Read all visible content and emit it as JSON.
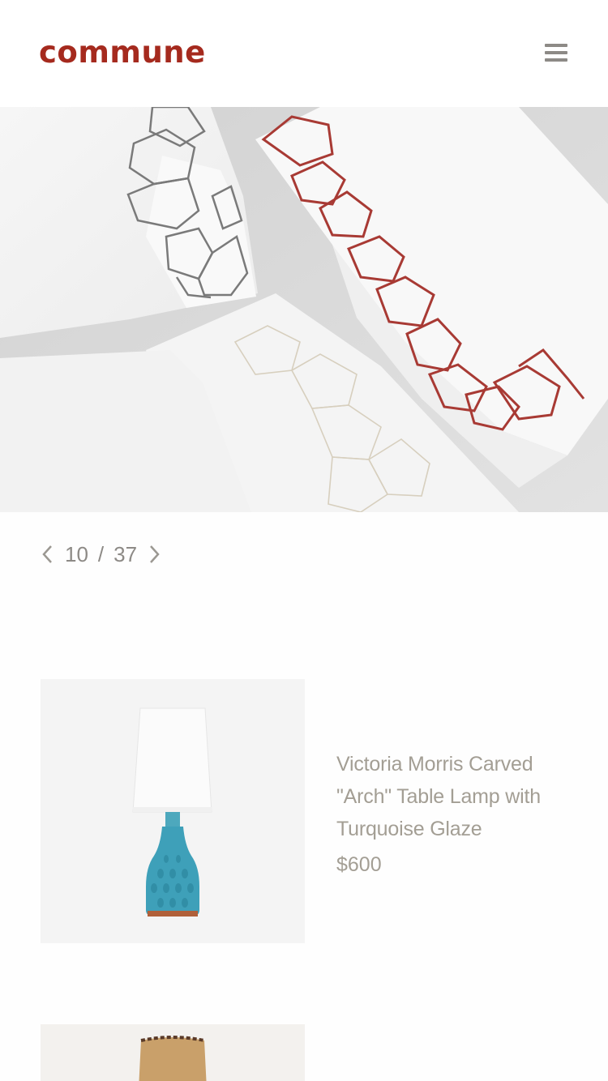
{
  "header": {
    "logo_text": "commune",
    "menu_icon": "hamburger-menu-icon"
  },
  "colors": {
    "brand": "#a52a1e",
    "muted_text": "#a39e94",
    "pager_text": "#8d8a86"
  },
  "hero": {
    "image": "embroidered-white-linens-photo"
  },
  "pager": {
    "current": "10",
    "separator": "/",
    "total": "37",
    "prev_icon": "chevron-left-icon",
    "next_icon": "chevron-right-icon"
  },
  "products": [
    {
      "title": "Victoria Morris Carved \"Arch\" Table Lamp with Turquoise Glaze",
      "price": "$600",
      "image": "turquoise-table-lamp-photo"
    },
    {
      "title": "",
      "price": "",
      "image": "leather-stitched-lamp-photo"
    }
  ]
}
